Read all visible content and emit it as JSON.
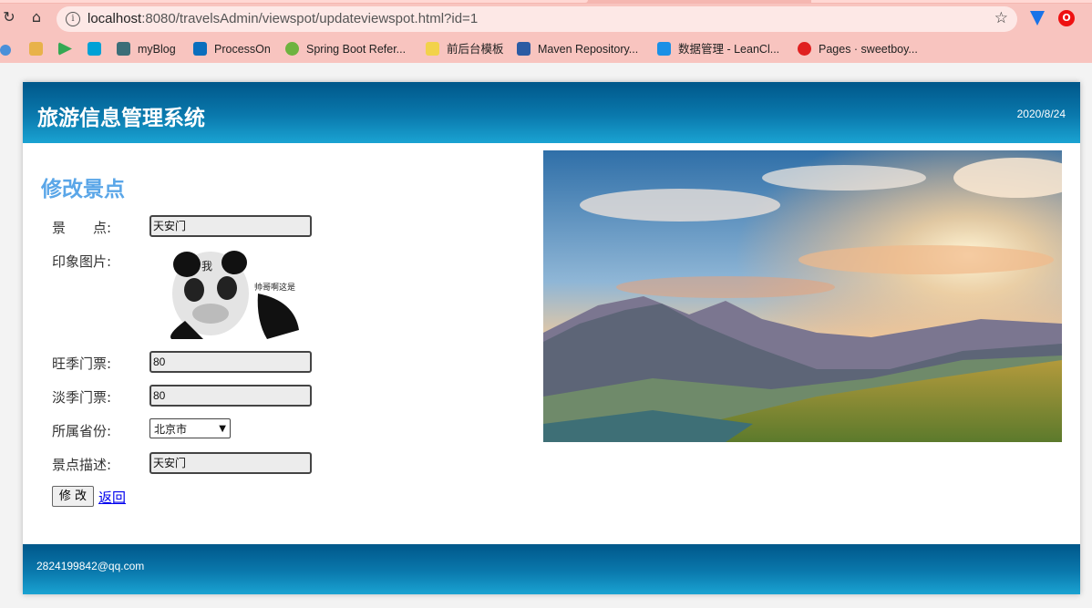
{
  "browser": {
    "url_host": "localhost",
    "url_path": ":8080/travelsAdmin/viewspot/updateviewspot.html?id=1",
    "bookmarks": [
      {
        "label": "myBlog",
        "color": "#3b6e78"
      },
      {
        "label": "ProcessOn",
        "color": "#0a6ebd"
      },
      {
        "label": "Spring Boot Refer...",
        "color": "#6db33f"
      },
      {
        "label": "前后台模板",
        "color": "#f2d24b"
      },
      {
        "label": "Maven Repository...",
        "color": "#2b5ba3"
      },
      {
        "label": "数据管理 - LeanCl...",
        "color": "#1a90e6"
      },
      {
        "label": "Pages · sweetboy...",
        "color": "#e02020"
      }
    ]
  },
  "app": {
    "title": "旅游信息管理系统",
    "date": "2020/8/24",
    "footer_email": "2824199842@qq.com"
  },
  "form": {
    "title": "修改景点",
    "name_label": "景　　点:",
    "name_value": "天安门",
    "image_label": "印象图片:",
    "image_caption_char": "我",
    "image_caption_text": "帅哥啊这是",
    "peak_price_label": "旺季门票:",
    "peak_price_value": "80",
    "off_price_label": "淡季门票:",
    "off_price_value": "80",
    "province_label": "所属省份:",
    "province_value": "北京市",
    "desc_label": "景点描述:",
    "desc_value": "天安门",
    "submit_label": "修 改",
    "back_label": "返回"
  },
  "colors": {
    "header_dark": "#00578a",
    "header_light": "#1aa3d2",
    "form_title": "#5aa6e8",
    "browser_chrome": "#f8c4bf"
  }
}
